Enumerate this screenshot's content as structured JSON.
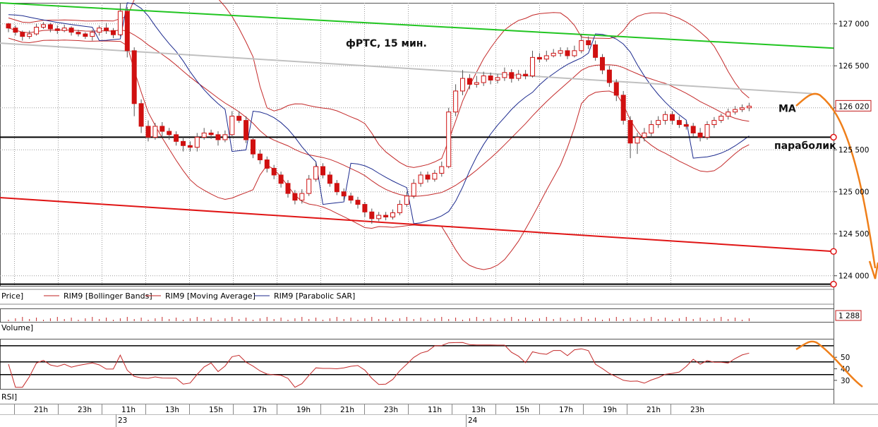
{
  "chart_data": {
    "type": "candlestick",
    "title": "фРТС,  15 мин.",
    "price_ticks": [
      "127 000",
      "126 500",
      "126 000",
      "125 500",
      "125 000",
      "124 500",
      "124 000"
    ],
    "price_tick_values": [
      127000,
      126500,
      126000,
      125500,
      125000,
      124500,
      124000
    ],
    "ylim": [
      123880,
      127250
    ],
    "last_price_label": "126 020",
    "last_price": 126020,
    "candles": [
      [
        127000,
        126950,
        127010,
        126900
      ],
      [
        126950,
        126900,
        126980,
        126860
      ],
      [
        126900,
        126850,
        126920,
        126800
      ],
      [
        126850,
        126880,
        126920,
        126820
      ],
      [
        126880,
        126960,
        127000,
        126860
      ],
      [
        126960,
        126990,
        127020,
        126940
      ],
      [
        126990,
        126940,
        127010,
        126900
      ],
      [
        126940,
        126920,
        126980,
        126880
      ],
      [
        126920,
        126950,
        126990,
        126900
      ],
      [
        126950,
        126900,
        126970,
        126860
      ],
      [
        126900,
        126880,
        126930,
        126850
      ],
      [
        126880,
        126850,
        126900,
        126820
      ],
      [
        126850,
        126900,
        126930,
        126800
      ],
      [
        126900,
        126950,
        126980,
        126860
      ],
      [
        126950,
        126920,
        127010,
        126880
      ],
      [
        126920,
        126870,
        126950,
        126830
      ],
      [
        126870,
        127150,
        127250,
        126850
      ],
      [
        127150,
        126680,
        127200,
        126600
      ],
      [
        126680,
        126050,
        126720,
        125900
      ],
      [
        126050,
        125780,
        126100,
        125700
      ],
      [
        125780,
        125650,
        125850,
        125600
      ],
      [
        125650,
        125780,
        125820,
        125620
      ],
      [
        125780,
        125720,
        125830,
        125650
      ],
      [
        125720,
        125680,
        125760,
        125620
      ],
      [
        125680,
        125600,
        125720,
        125550
      ],
      [
        125600,
        125550,
        125650,
        125480
      ],
      [
        125550,
        125530,
        125600,
        125480
      ],
      [
        125530,
        125650,
        125700,
        125480
      ],
      [
        125650,
        125700,
        125760,
        125620
      ],
      [
        125700,
        125680,
        125740,
        125630
      ],
      [
        125680,
        125620,
        125720,
        125550
      ],
      [
        125620,
        125680,
        125730,
        125590
      ],
      [
        125680,
        125900,
        125960,
        125650
      ],
      [
        125900,
        125850,
        125960,
        125820
      ],
      [
        125850,
        125620,
        125900,
        125580
      ],
      [
        125620,
        125450,
        125660,
        125400
      ],
      [
        125450,
        125380,
        125500,
        125330
      ],
      [
        125380,
        125280,
        125420,
        125230
      ],
      [
        125280,
        125200,
        125320,
        125150
      ],
      [
        125200,
        125100,
        125240,
        125050
      ],
      [
        125100,
        124980,
        125140,
        124930
      ],
      [
        124980,
        124900,
        125020,
        124850
      ],
      [
        124900,
        124980,
        125030,
        124860
      ],
      [
        124980,
        125150,
        125200,
        124950
      ],
      [
        125150,
        125300,
        125350,
        125120
      ],
      [
        125300,
        125200,
        125340,
        125160
      ],
      [
        125200,
        125100,
        125240,
        125060
      ],
      [
        125100,
        125000,
        125140,
        124960
      ],
      [
        125000,
        124950,
        125040,
        124900
      ],
      [
        124950,
        124900,
        124990,
        124860
      ],
      [
        124900,
        124850,
        124940,
        124800
      ],
      [
        124850,
        124760,
        124880,
        124700
      ],
      [
        124760,
        124680,
        124800,
        124620
      ],
      [
        124680,
        124720,
        124760,
        124650
      ],
      [
        124720,
        124700,
        124760,
        124660
      ],
      [
        124700,
        124750,
        124790,
        124670
      ],
      [
        124750,
        124850,
        124900,
        124720
      ],
      [
        124850,
        124950,
        125000,
        124820
      ],
      [
        124950,
        125100,
        125150,
        124920
      ],
      [
        125100,
        125200,
        125240,
        125060
      ],
      [
        125200,
        125150,
        125240,
        125110
      ],
      [
        125150,
        125220,
        125260,
        125120
      ],
      [
        125220,
        125300,
        125360,
        125180
      ],
      [
        125300,
        125950,
        126000,
        125280
      ],
      [
        125950,
        126200,
        126280,
        125900
      ],
      [
        126200,
        126350,
        126450,
        126150
      ],
      [
        126350,
        126280,
        126400,
        126220
      ],
      [
        126280,
        126300,
        126380,
        126240
      ],
      [
        126300,
        126380,
        126430,
        126260
      ],
      [
        126380,
        126330,
        126420,
        126280
      ],
      [
        126330,
        126360,
        126400,
        126290
      ],
      [
        126360,
        126420,
        126480,
        126320
      ],
      [
        126420,
        126350,
        126460,
        126300
      ],
      [
        126350,
        126400,
        126450,
        126320
      ],
      [
        126400,
        126380,
        126450,
        126340
      ],
      [
        126380,
        126600,
        126680,
        126360
      ],
      [
        126600,
        126580,
        126650,
        126540
      ],
      [
        126580,
        126620,
        126680,
        126550
      ],
      [
        126620,
        126650,
        126700,
        126600
      ],
      [
        126650,
        126680,
        126720,
        126610
      ],
      [
        126680,
        126620,
        126720,
        126580
      ],
      [
        126620,
        126680,
        126740,
        126600
      ],
      [
        126680,
        126800,
        126880,
        126650
      ],
      [
        126800,
        126750,
        126850,
        126700
      ],
      [
        126750,
        126600,
        126800,
        126560
      ],
      [
        126600,
        126450,
        126640,
        126400
      ],
      [
        126450,
        126300,
        126500,
        126250
      ],
      [
        126300,
        126150,
        126340,
        126080
      ],
      [
        126150,
        125850,
        126200,
        125800
      ],
      [
        125850,
        125580,
        125900,
        125400
      ],
      [
        125580,
        125650,
        125700,
        125450
      ],
      [
        125650,
        125700,
        125760,
        125600
      ],
      [
        125700,
        125800,
        125850,
        125650
      ],
      [
        125800,
        125850,
        125900,
        125760
      ],
      [
        125850,
        125920,
        125960,
        125800
      ],
      [
        125920,
        125850,
        125960,
        125800
      ],
      [
        125850,
        125800,
        125900,
        125760
      ],
      [
        125800,
        125780,
        125840,
        125740
      ],
      [
        125780,
        125700,
        125820,
        125660
      ],
      [
        125700,
        125650,
        125760,
        125600
      ],
      [
        125650,
        125800,
        125840,
        125620
      ],
      [
        125800,
        125850,
        125890,
        125760
      ],
      [
        125850,
        125900,
        125930,
        125820
      ],
      [
        125900,
        125950,
        125990,
        125860
      ],
      [
        125950,
        125980,
        126020,
        125920
      ],
      [
        125980,
        126000,
        126040,
        125950
      ],
      [
        126000,
        126020,
        126060,
        125960
      ]
    ],
    "support_lines": [
      {
        "name": "green-trendline",
        "color": "#21c521",
        "y_start": 127250,
        "y_end": 126710
      },
      {
        "name": "gray-trendline",
        "color": "#c0c0c0",
        "y_start": 126770,
        "y_end": 126170
      },
      {
        "name": "red-trendline",
        "color": "#e01515",
        "y_start": 124930,
        "y_end": 124290
      },
      {
        "name": "level-125650",
        "color": "#000000",
        "y_start": 125650,
        "y_end": 125650
      },
      {
        "name": "level-123900",
        "color": "#000000",
        "y_start": 123900,
        "y_end": 123900
      }
    ],
    "annotations": [
      {
        "text": "МА",
        "x_index": 110.2,
        "price": 126000
      },
      {
        "text": "параболик",
        "x_index": 109.6,
        "price": 125560
      }
    ],
    "legend": [
      {
        "text": "Price]",
        "color": "#000000",
        "has_line": false
      },
      {
        "text": "RIM9 [Bollinger Bands]",
        "color": "#c02020",
        "has_line": true
      },
      {
        "text": "RIM9 [Moving Average]",
        "color": "#c02020",
        "has_line": true
      },
      {
        "text": "RIM9 [Parabolic SAR]",
        "color": "#1c2a8e",
        "has_line": true
      }
    ],
    "volume": {
      "label": "Volume]",
      "last_label": "1 288"
    },
    "rsi": {
      "label": "RSI]",
      "ticks": [
        "50",
        "40",
        "30"
      ],
      "tick_values": [
        50,
        40,
        30
      ],
      "levels": [
        60,
        46,
        35
      ]
    },
    "time_ticks": [
      "21h",
      "23h",
      "11h",
      "13h",
      "15h",
      "17h",
      "19h",
      "21h",
      "23h",
      "11h",
      "13h",
      "15h",
      "17h",
      "19h",
      "21h",
      "23h"
    ],
    "date_labels": [
      {
        "text": "23"
      },
      {
        "text": "24"
      }
    ]
  }
}
